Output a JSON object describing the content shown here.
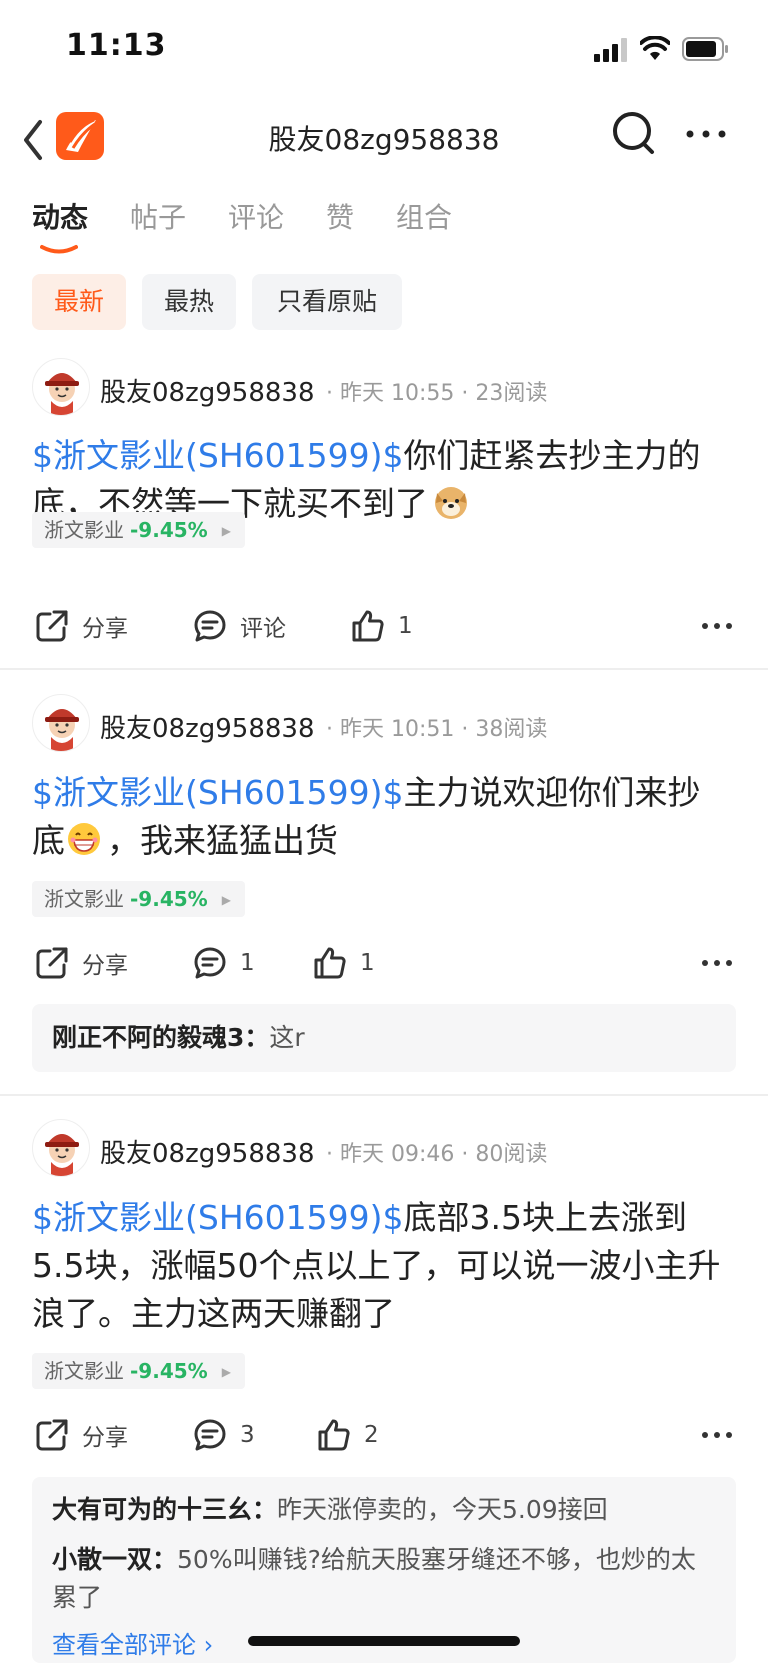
{
  "status_bar": {
    "time": "11:13"
  },
  "nav": {
    "title": "股友08zg958838"
  },
  "tabs": [
    {
      "label": "动态",
      "active": true
    },
    {
      "label": "帖子",
      "active": false
    },
    {
      "label": "评论",
      "active": false
    },
    {
      "label": "赞",
      "active": false
    },
    {
      "label": "组合",
      "active": false
    }
  ],
  "filters": [
    {
      "label": "最新",
      "active": true
    },
    {
      "label": "最热",
      "active": false
    },
    {
      "label": "只看原贴",
      "active": false
    }
  ],
  "actions_labels": {
    "share": "分享",
    "comment": "评论"
  },
  "posts": [
    {
      "author": "股友08zg958838",
      "time": "昨天 10:55",
      "reads": "23阅读",
      "stock_link": "$浙文影业(SH601599)$",
      "text": "你们赶紧去抄主力的底，不然等一下就买不到了",
      "emoji": "doge-emoji",
      "tag_name": "浙文影业",
      "tag_change": "-9.45%",
      "comment_label": "评论",
      "likes": "1",
      "comments": []
    },
    {
      "author": "股友08zg958838",
      "time": "昨天 10:51",
      "reads": "38阅读",
      "stock_link": "$浙文影业(SH601599)$",
      "text": "主力说欢迎你们来抄底",
      "text2": "，我来猛猛出货",
      "emoji": "grin-emoji",
      "tag_name": "浙文影业",
      "tag_change": "-9.45%",
      "comment_label": "1",
      "likes": "1",
      "comments": [
        {
          "user": "刚正不阿的毅魂3：",
          "text": "这r"
        }
      ]
    },
    {
      "author": "股友08zg958838",
      "time": "昨天 09:46",
      "reads": "80阅读",
      "stock_link": "$浙文影业(SH601599)$",
      "text": "底部3.5块上去涨到5.5块，涨幅50个点以上了，可以说一波小主升浪了。主力这两天赚翻了",
      "tag_name": "浙文影业",
      "tag_change": "-9.45%",
      "comment_label": "3",
      "likes": "2",
      "comments": [
        {
          "user": "大有可为的十三幺：",
          "text": "昨天涨停卖的，今天5.09接回"
        },
        {
          "user": "小散一双：",
          "text": "50%叫赚钱?给航天股塞牙缝还不够，也炒的太累了"
        }
      ],
      "view_all": "查看全部评论 ›"
    }
  ],
  "colors": {
    "accent": "#ff5a1a",
    "link": "#2f7ce8",
    "down": "#28b463"
  }
}
